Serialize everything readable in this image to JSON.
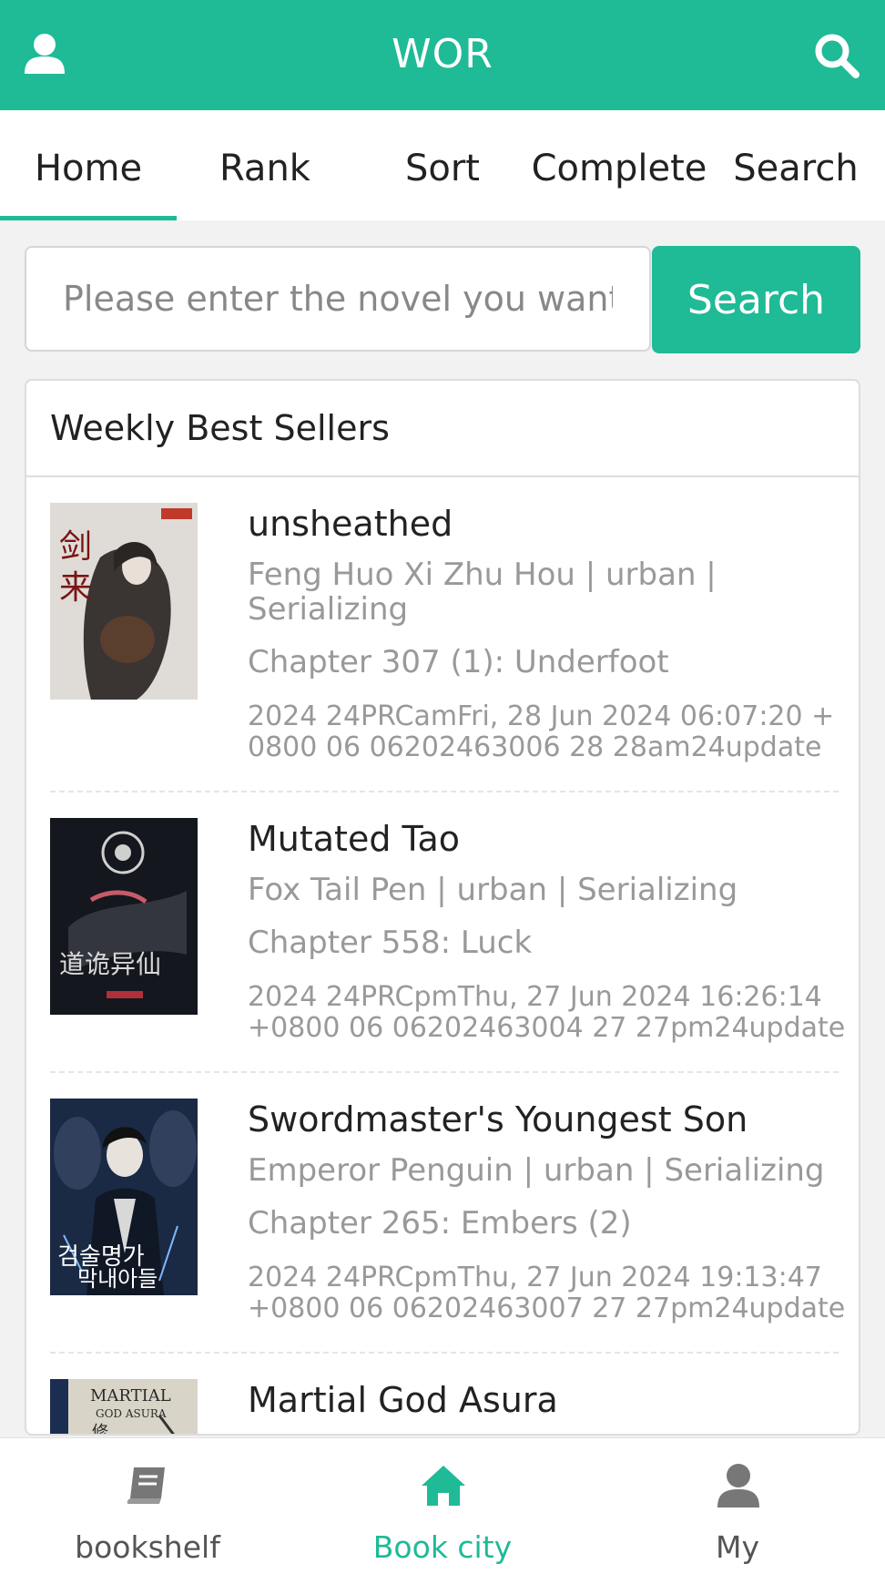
{
  "header": {
    "title": "WOR",
    "accent": "#1fba96"
  },
  "tabs": [
    {
      "label": "Home",
      "active": true
    },
    {
      "label": "Rank"
    },
    {
      "label": "Sort"
    },
    {
      "label": "Complete"
    },
    {
      "label": "Search"
    }
  ],
  "search": {
    "placeholder": "Please enter the novel you want to search",
    "button_label": "Search"
  },
  "weekly": {
    "title": "Weekly Best Sellers",
    "books": [
      {
        "name": "unsheathed",
        "meta": "Feng Huo Xi Zhu Hou | urban | Serializing",
        "chapter": "Chapter 307 (1): Underfoot",
        "update": "2024 24PRCamFri, 28 Jun 2024 06:07:20 +0800 06 06202463006 28 28am24update"
      },
      {
        "name": "Mutated Tao",
        "meta": "Fox Tail Pen | urban | Serializing",
        "chapter": "Chapter 558: Luck",
        "update": "2024 24PRCpmThu, 27 Jun 2024 16:26:14 +0800 06 06202463004 27 27pm24update"
      },
      {
        "name": "Swordmaster's Youngest Son",
        "meta": "Emperor Penguin | urban | Serializing",
        "chapter": "Chapter 265: Embers (2)",
        "update": "2024 24PRCpmThu, 27 Jun 2024 19:13:47 +0800 06 06202463007 27 27pm24update"
      },
      {
        "name": "Martial God Asura",
        "meta": "",
        "chapter": "",
        "update": ""
      }
    ]
  },
  "bottom_nav": [
    {
      "label": "bookshelf",
      "icon": "book-icon"
    },
    {
      "label": "Book city",
      "icon": "home-icon",
      "active": true
    },
    {
      "label": "My",
      "icon": "user-icon"
    }
  ]
}
